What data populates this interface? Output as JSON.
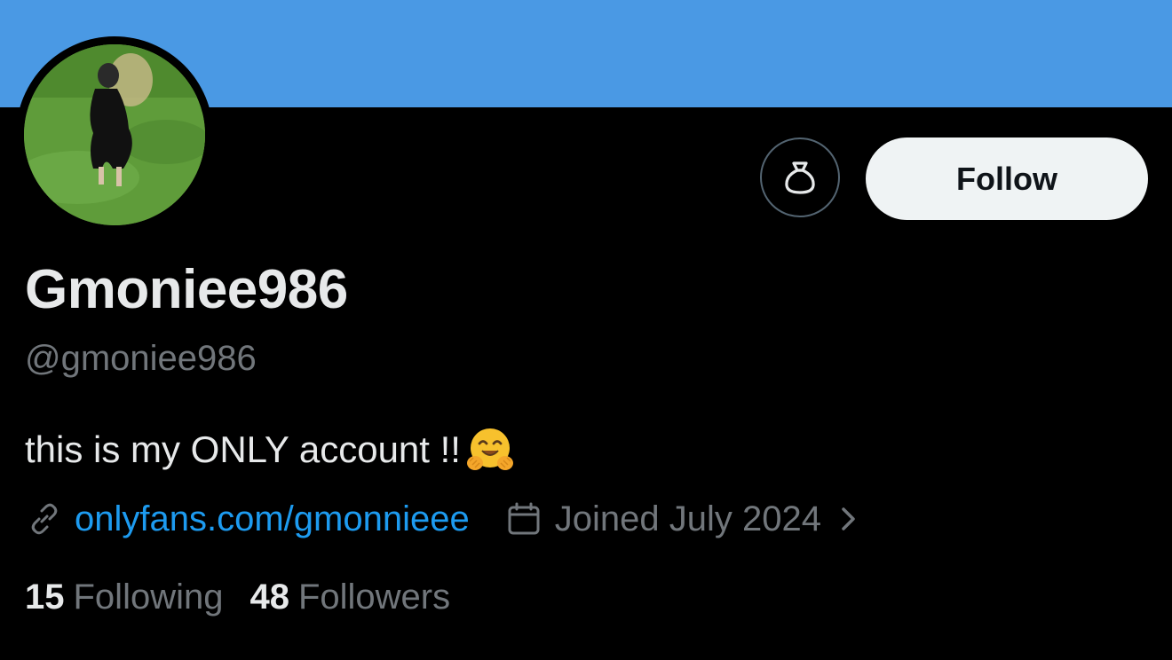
{
  "profile": {
    "display_name": "Gmoniee986",
    "handle": "@gmoniee986",
    "bio_text": "this is my ONLY account !!",
    "bio_emoji": "hugging-face",
    "website": "onlyfans.com/gmonnieee",
    "joined": "Joined July 2024"
  },
  "actions": {
    "follow_label": "Follow",
    "gift_icon": "money-bag-icon"
  },
  "stats": {
    "following_count": "15",
    "following_label": "Following",
    "followers_count": "48",
    "followers_label": "Followers"
  },
  "icons": {
    "link": "link-icon",
    "calendar": "calendar-icon",
    "chevron": "chevron-right-icon"
  },
  "colors": {
    "banner": "#4a99e4",
    "background": "#000000",
    "link": "#1d9bf0",
    "secondary_text": "#71767b",
    "primary_text": "#e7e9ea",
    "follow_button_bg": "#eff3f4"
  }
}
